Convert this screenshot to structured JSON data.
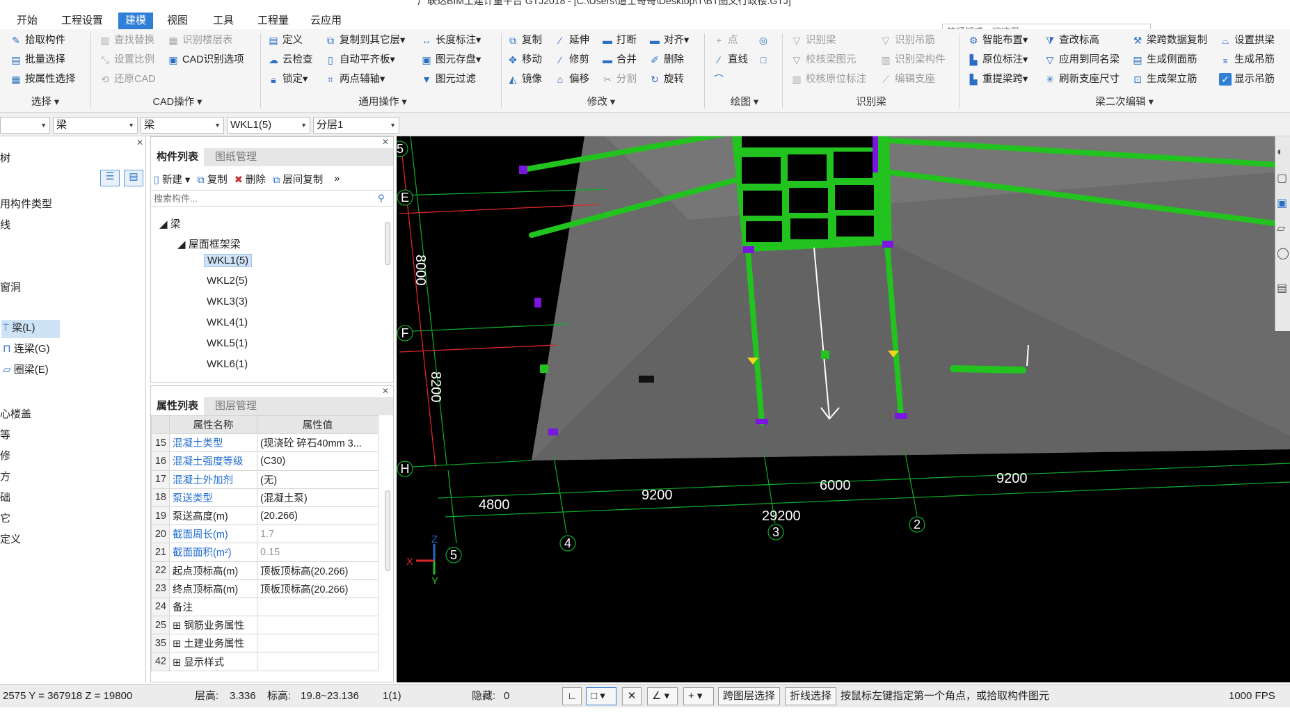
{
  "window": {
    "title": "广联达BIM土建计量平台 GTJ2018 - [C:\\Users\\道士哥哥\\Desktop\\T\\BT图文行政楼.GTJ]"
  },
  "menu": [
    "开始",
    "工程设置",
    "建模",
    "视图",
    "工具",
    "工程量",
    "云应用"
  ],
  "menu_active": "建模",
  "search": {
    "placeholder": "答疑解惑，搜这里"
  },
  "ribbon": {
    "select": {
      "items": [
        "拾取构件",
        "批量选择",
        "按属性选择"
      ],
      "group": "选择"
    },
    "cad": {
      "items": [
        "查找替换",
        "识别楼层表",
        "设置比例",
        "CAD识别选项",
        "还原CAD"
      ],
      "group": "CAD操作"
    },
    "common": {
      "items": [
        "定义",
        "复制到其它层",
        "长度标注",
        "云检查",
        "自动平齐板",
        "图元存盘",
        "锁定",
        "两点辅轴",
        "图元过滤"
      ],
      "group": "通用操作"
    },
    "modify": {
      "items": [
        "复制",
        "延伸",
        "打断",
        "对齐",
        "移动",
        "修剪",
        "合并",
        "删除",
        "镜像",
        "偏移",
        "分割",
        "旋转"
      ],
      "group": "修改"
    },
    "draw": {
      "items": [
        "点",
        "直线"
      ],
      "group": "绘图"
    },
    "recog": {
      "items": [
        "识别梁",
        "识别吊筋",
        "校核梁图元",
        "识别梁构件",
        "校核原位标注",
        "编辑支座"
      ],
      "group": "识别梁"
    },
    "beam2": {
      "items": [
        "智能布置",
        "查改标高",
        "梁跨数据复制",
        "设置拱梁",
        "原位标注",
        "应用到同名梁",
        "生成侧面筋",
        "生成吊筋",
        "重提梁跨",
        "刷新支座尺寸",
        "生成架立筋",
        "显示吊筋"
      ],
      "group": "梁二次编辑"
    }
  },
  "selectors": [
    "梁",
    "梁",
    "WKL1(5)",
    "分层1"
  ],
  "left_panel": {
    "items": [
      "树",
      "用构件类型",
      "线",
      "窗洞",
      "梁(L)",
      "连梁(G)",
      "圈梁(E)",
      "心楼盖",
      "等",
      "修",
      "方",
      "础",
      "它",
      "定义"
    ]
  },
  "component_list": {
    "tabs": [
      "构件列表",
      "图纸管理"
    ],
    "toolbar": [
      "新建",
      "复制",
      "删除",
      "层间复制"
    ],
    "search_placeholder": "搜索构件...",
    "tree": {
      "root": "梁",
      "group": "屋面框架梁",
      "items": [
        "WKL1(5)",
        "WKL2(5)",
        "WKL3(3)",
        "WKL4(1)",
        "WKL5(1)",
        "WKL6(1)"
      ],
      "selected": "WKL1(5)"
    }
  },
  "property_list": {
    "tabs": [
      "属性列表",
      "图层管理"
    ],
    "headers": [
      "属性名称",
      "属性值"
    ],
    "rows": [
      {
        "n": "15",
        "k": "混凝土类型",
        "v": "(现浇砼 碎石40mm 3...",
        "kstyle": "blue"
      },
      {
        "n": "16",
        "k": "混凝土强度等级",
        "v": "(C30)",
        "kstyle": "blue"
      },
      {
        "n": "17",
        "k": "混凝土外加剂",
        "v": "(无)",
        "kstyle": "blue"
      },
      {
        "n": "18",
        "k": "泵送类型",
        "v": "(混凝土泵)",
        "kstyle": "blue"
      },
      {
        "n": "19",
        "k": "泵送高度(m)",
        "v": "(20.266)",
        "kstyle": ""
      },
      {
        "n": "20",
        "k": "截面周长(m)",
        "v": "1.7",
        "kstyle": "blue",
        "vstyle": "grey"
      },
      {
        "n": "21",
        "k": "截面面积(m²)",
        "v": "0.15",
        "kstyle": "blue",
        "vstyle": "grey"
      },
      {
        "n": "22",
        "k": "起点顶标高(m)",
        "v": "顶板顶标高(20.266)",
        "kstyle": ""
      },
      {
        "n": "23",
        "k": "终点顶标高(m)",
        "v": "顶板顶标高(20.266)",
        "kstyle": ""
      },
      {
        "n": "24",
        "k": "备注",
        "v": "",
        "kstyle": ""
      },
      {
        "n": "25",
        "k": "钢筋业务属性",
        "v": "",
        "kstyle": "",
        "expand": true
      },
      {
        "n": "35",
        "k": "土建业务属性",
        "v": "",
        "kstyle": "",
        "expand": true
      },
      {
        "n": "42",
        "k": "显示样式",
        "v": "",
        "kstyle": "",
        "expand": true
      }
    ]
  },
  "viewport": {
    "axis_labels": [
      "5",
      "E",
      "F",
      "H",
      "5",
      "4",
      "3",
      "2"
    ],
    "dims_vertical": [
      "8000",
      "8200"
    ],
    "dims_horizontal": [
      "4800",
      "9200",
      "6000",
      "9200"
    ],
    "dim_total": "29200",
    "coord_axes": [
      "X",
      "Y",
      "Z"
    ],
    "colors": {
      "beam": "#22c21f",
      "slab": "#6b6b6b",
      "grid": "#0fae2a",
      "redline": "#e0262a",
      "vertex": "#7a16e0"
    }
  },
  "status": {
    "coords": "2575 Y = 367918 Z = 19800",
    "floor_height_label": "层高:",
    "floor_height": "3.336",
    "elev_label": "标高:",
    "elev": "19.8~23.136",
    "count": "1(1)",
    "hidden_label": "隐藏:",
    "hidden": "0",
    "btn_cross": "跨图层选择",
    "btn_polyline": "折线选择",
    "hint": "按鼠标左键指定第一个角点，或拾取构件图元",
    "fps": "1000 FPS"
  }
}
